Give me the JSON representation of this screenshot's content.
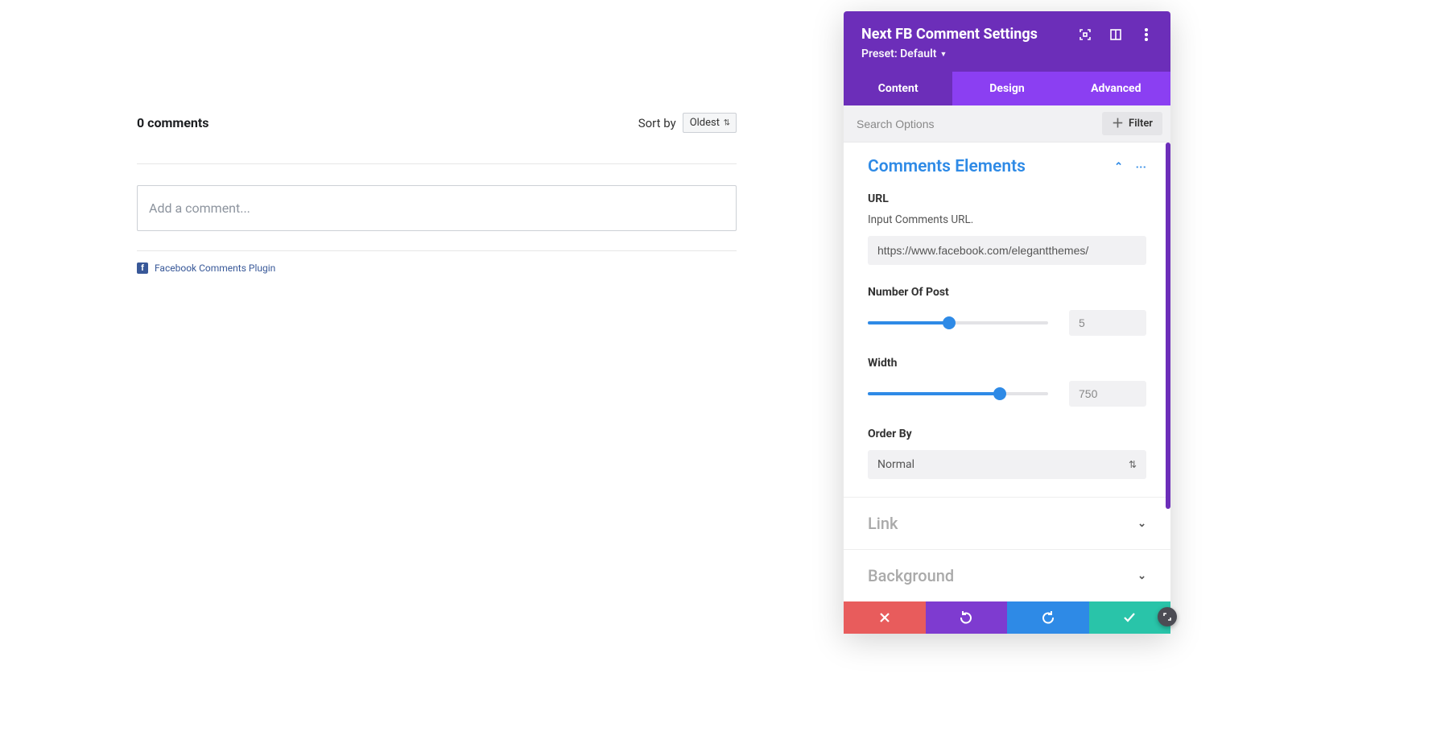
{
  "preview": {
    "comments_count": "0 comments",
    "sort_by_label": "Sort by",
    "sort_selected": "Oldest",
    "add_comment_placeholder": "Add a comment...",
    "footer_link": "Facebook Comments Plugin",
    "footer_badge": "f"
  },
  "panel": {
    "title": "Next FB Comment Settings",
    "preset_label": "Preset: Default",
    "tabs": {
      "content": "Content",
      "design": "Design",
      "advanced": "Advanced"
    },
    "search_placeholder": "Search Options",
    "filter_label": "Filter"
  },
  "sections": {
    "comments_elements": {
      "title": "Comments Elements",
      "url_label": "URL",
      "url_hint": "Input Comments URL.",
      "url_value": "https://www.facebook.com/elegantthemes/",
      "number_of_post_label": "Number Of Post",
      "number_of_post_value": "5",
      "number_of_post_fill_pct": 45,
      "width_label": "Width",
      "width_value": "750",
      "width_fill_pct": 73,
      "order_by_label": "Order By",
      "order_by_value": "Normal"
    },
    "link": {
      "title": "Link"
    },
    "background": {
      "title": "Background"
    }
  }
}
